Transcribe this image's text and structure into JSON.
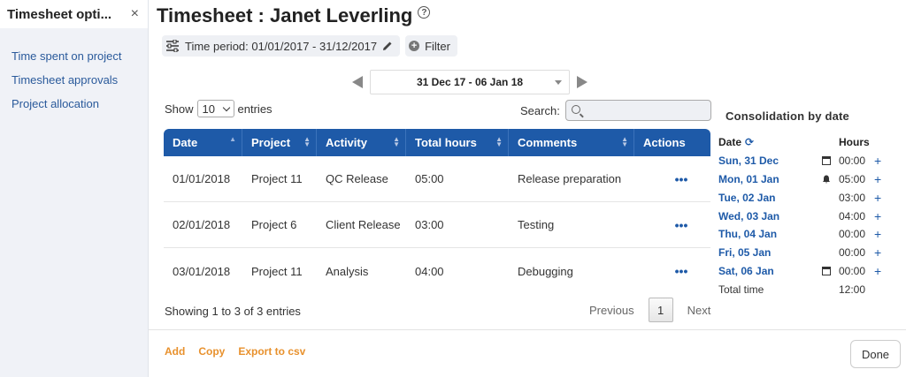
{
  "sidebar": {
    "title": "Timesheet opti...",
    "close": "×",
    "items": [
      {
        "label": "Time spent on project"
      },
      {
        "label": "Timesheet approvals"
      },
      {
        "label": "Project allocation"
      }
    ]
  },
  "header": {
    "title": "Timesheet : Janet Leverling",
    "help": "?"
  },
  "filters": {
    "time_period": "Time period: 01/01/2017 - 31/12/2017",
    "filter": "Filter"
  },
  "date_nav": {
    "range": "31 Dec 17 - 06 Jan 18"
  },
  "table_controls": {
    "show": "Show",
    "entries_value": "10",
    "entries": "entries",
    "search": "Search:"
  },
  "table": {
    "columns": [
      "Date",
      "Project",
      "Activity",
      "Total hours",
      "Comments",
      "Actions"
    ],
    "rows": [
      {
        "date": "01/01/2018",
        "project": "Project 11",
        "activity": "QC Release",
        "hours": "05:00",
        "comments": "Release preparation",
        "actions": "•••"
      },
      {
        "date": "02/01/2018",
        "project": "Project 6",
        "activity": "Client Release",
        "hours": "03:00",
        "comments": "Testing",
        "actions": "•••"
      },
      {
        "date": "03/01/2018",
        "project": "Project 11",
        "activity": "Analysis",
        "hours": "04:00",
        "comments": "Debugging",
        "actions": "•••"
      }
    ]
  },
  "pagination": {
    "showing": "Showing 1 to 3 of 3 entries",
    "previous": "Previous",
    "page": "1",
    "next": "Next"
  },
  "footer": {
    "add": "Add",
    "copy": "Copy",
    "export": "Export to csv",
    "done": "Done"
  },
  "consolidation": {
    "title": "Consolidation by date",
    "date_header": "Date",
    "hours_header": "Hours",
    "rows": [
      {
        "date": "Sun, 31 Dec",
        "icon": "calendar-icon",
        "hours": "00:00",
        "plus": "+"
      },
      {
        "date": "Mon, 01 Jan",
        "icon": "bell-icon",
        "hours": "05:00",
        "plus": "+"
      },
      {
        "date": "Tue, 02 Jan",
        "icon": "",
        "hours": "03:00",
        "plus": "+"
      },
      {
        "date": "Wed, 03 Jan",
        "icon": "",
        "hours": "04:00",
        "plus": "+"
      },
      {
        "date": "Thu, 04 Jan",
        "icon": "",
        "hours": "00:00",
        "plus": "+"
      },
      {
        "date": "Fri, 05 Jan",
        "icon": "",
        "hours": "00:00",
        "plus": "+"
      },
      {
        "date": "Sat, 06 Jan",
        "icon": "calendar-icon",
        "hours": "00:00",
        "plus": "+"
      }
    ],
    "total_label": "Total time",
    "total_value": "12:00"
  },
  "colors": {
    "primary": "#1e5aa8",
    "link": "#2a5a9b",
    "accent": "#e8912d",
    "sidebar_bg": "#f0f2f7"
  }
}
